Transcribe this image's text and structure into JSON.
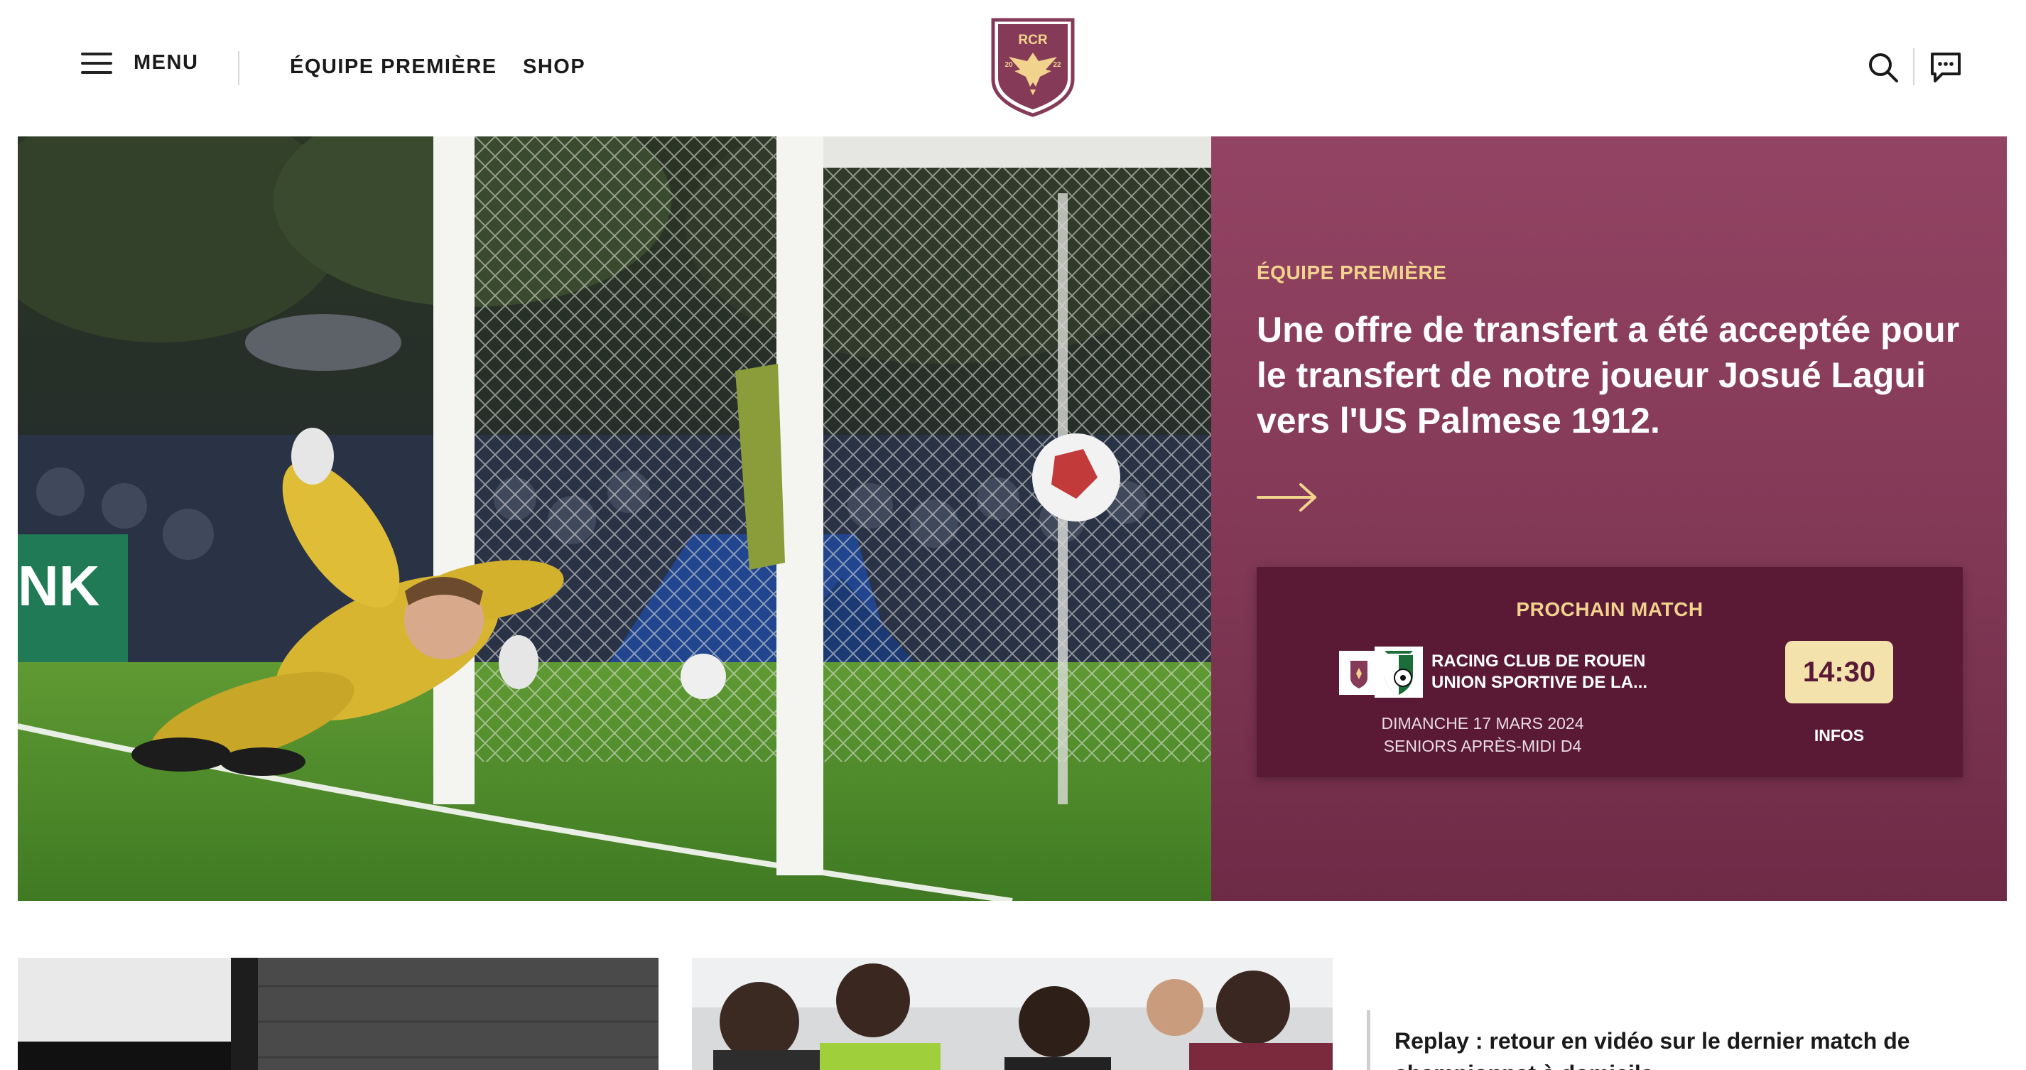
{
  "header": {
    "menu_label": "MENU",
    "nav": [
      {
        "label": "ÉQUIPE PREMIÈRE"
      },
      {
        "label": "SHOP"
      }
    ],
    "logo": {
      "text": "RCR",
      "year_left": "20",
      "year_right": "22"
    },
    "icons": [
      "search-icon",
      "chat-icon",
      "hamburger-icon"
    ]
  },
  "hero": {
    "kicker": "ÉQUIPE PREMIÈRE",
    "headline": "Une offre de transfert a été acceptée pour le transfert de notre joueur Josué Lagui vers l'US Palmese 1912.",
    "link_icon": "arrow-right-icon"
  },
  "next_match": {
    "title": "PROCHAIN MATCH",
    "home_team": "RACING CLUB DE ROUEN",
    "away_team": "UNION SPORTIVE DE LA...",
    "date": "DIMANCHE 17 MARS 2024",
    "competition": "SENIORS APRÈS-MIDI D4",
    "time": "14:30",
    "infos_label": "INFOS"
  },
  "news": {
    "side_title": "Replay : retour en vidéo sur le dernier match de championnat à domicile"
  },
  "colors": {
    "brand": "#853b58",
    "brand_dark": "#5a1a36",
    "gold": "#f1d38e",
    "badge": "#f4e2ad"
  }
}
